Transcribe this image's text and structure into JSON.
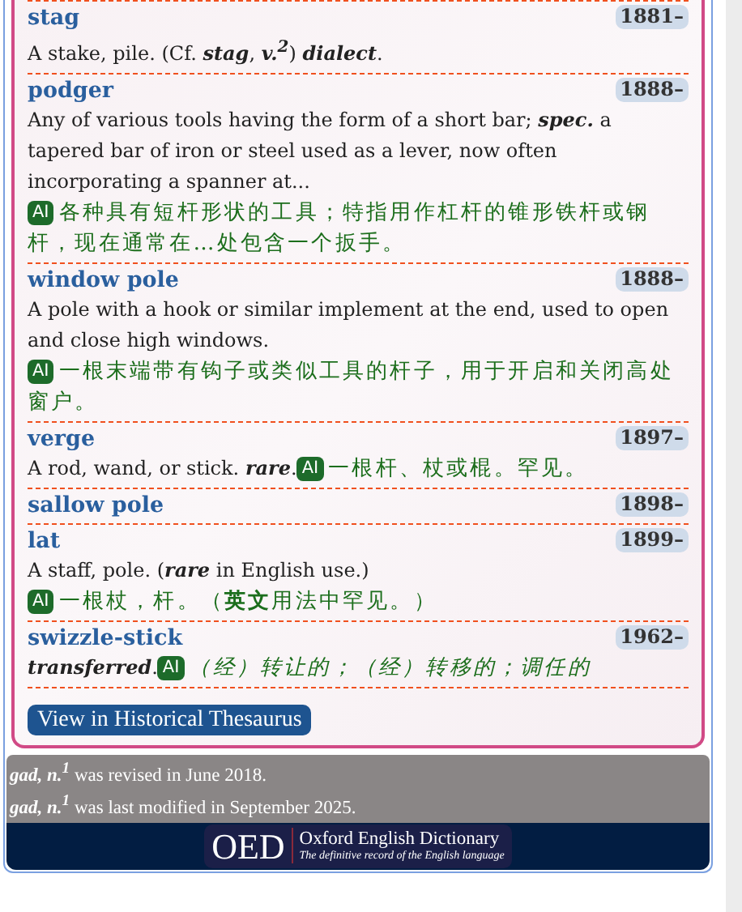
{
  "entries": [
    {
      "headword": "stag",
      "date": "1881–",
      "definition": "A stake, pile. (Cf. **stag**, **v.$^{2}$**) **dialect**.",
      "kind": "block"
    },
    {
      "headword": "podger",
      "date": "1888–",
      "definition": "Any of various tools having the form of a short bar; **spec.** a tapered bar of iron or steel used as a lever, now often incorporating a spanner at...",
      "ai": {
        "badge": "AI",
        "text": "各种具有短杆形状的工具；特指用作杠杆的锥形铁杆或钢杆，现在通常在…处包含一个扳手。"
      },
      "kind": "block"
    },
    {
      "headword": "window pole",
      "date": "1888–",
      "definition": "A pole with a hook or similar implement at the end, used to open and close high windows.",
      "ai": {
        "badge": "AI",
        "text": "一根末端带有钩子或类似工具的杆子，用于开启和关闭高处窗户。"
      },
      "kind": "block"
    },
    {
      "headword": "verge",
      "date": "1897–",
      "definition": "A rod, wand, or stick. **rare**.",
      "ai": {
        "badge": "AI",
        "text": "一根杆、杖或棍。罕见。"
      },
      "kind": "inline"
    },
    {
      "headword": "sallow pole",
      "date": "1898–",
      "kind": "block"
    },
    {
      "headword": "lat",
      "date": "1899–",
      "definition": "A staff, pole. (**rare** in English use.)",
      "ai": {
        "badge": "AI",
        "text": "一根杖，杆。（**英文**用法中罕见。）"
      },
      "kind": "block"
    },
    {
      "headword": "swizzle-stick",
      "date": "1962–",
      "definition": "**transferred**.",
      "ai": {
        "badge": "AI",
        "text": "*（经）转让的；（经）转移的；调任的*"
      },
      "kind": "inline"
    }
  ],
  "thesaurus_button": "View in Historical Thesaurus",
  "revision_notes": [
    "**gad, n.$^{1}$** was revised in June 2018.",
    "**gad, n.$^{1}$** was last modified in September 2025."
  ],
  "logo": {
    "mark": "OED",
    "name": "Oxford English Dictionary",
    "tagline": "The definitive record of the English language"
  }
}
